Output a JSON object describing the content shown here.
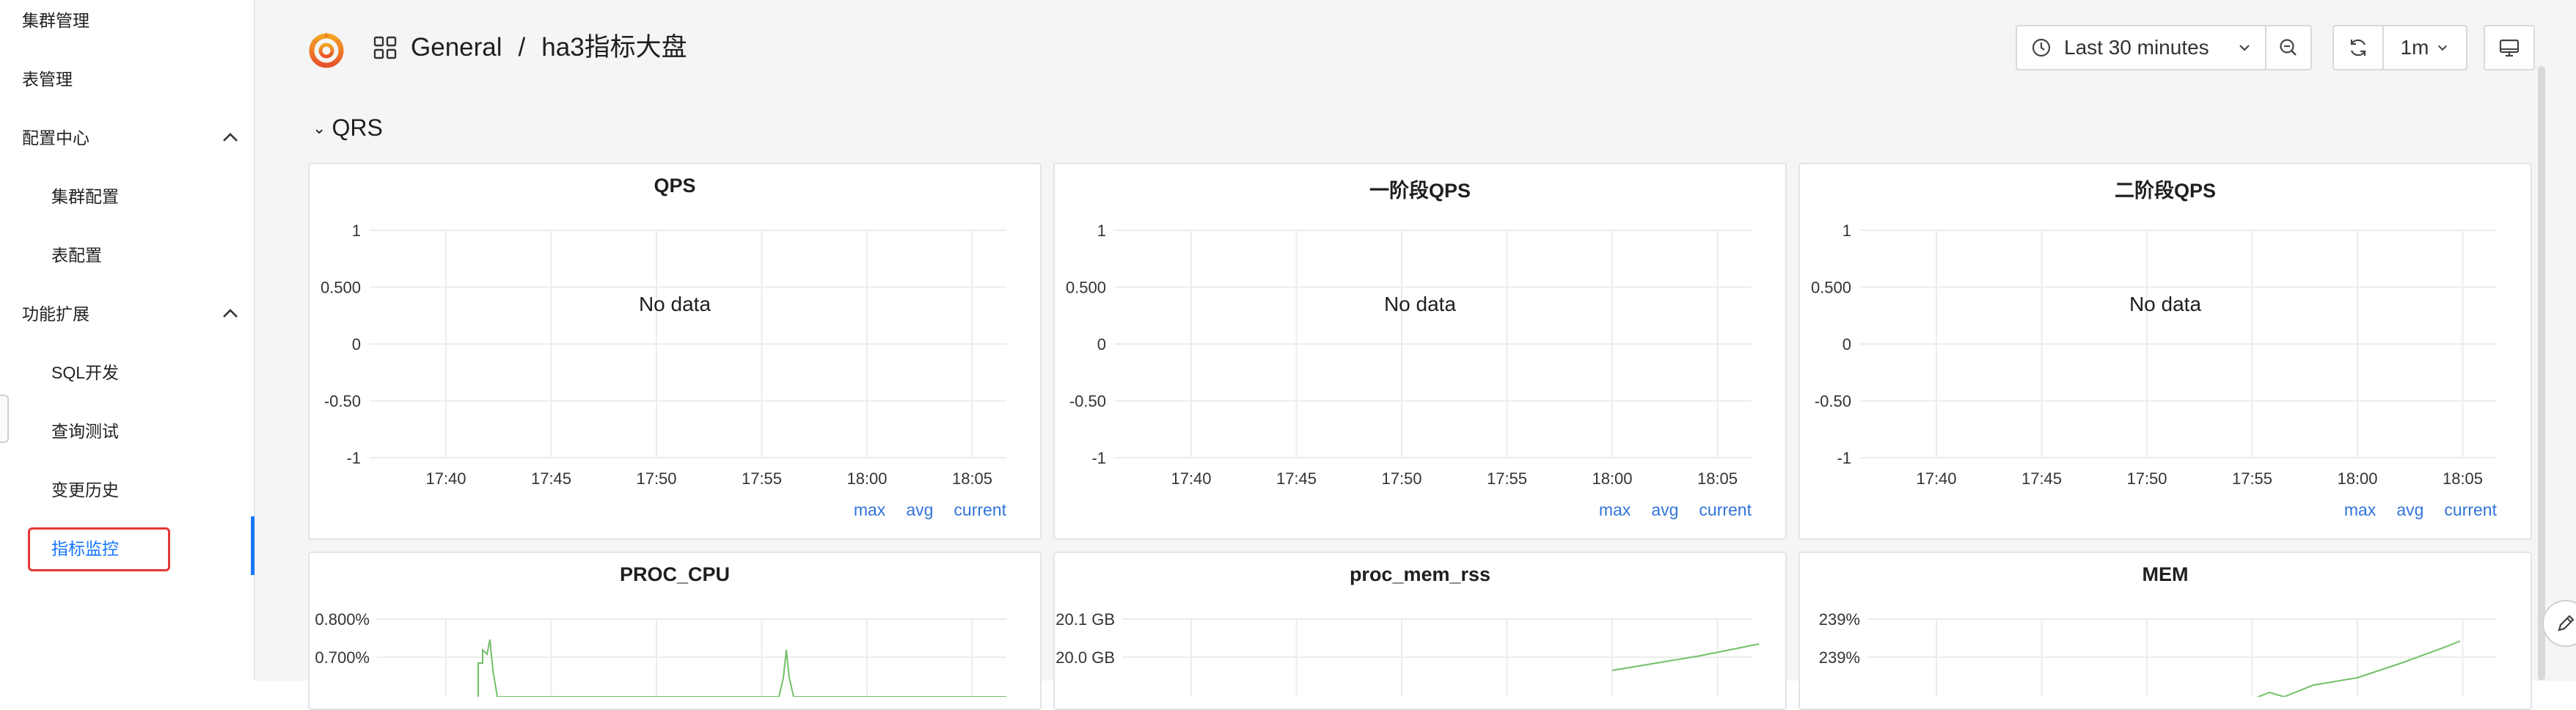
{
  "sidebar": {
    "items": [
      {
        "label": "集群管理"
      },
      {
        "label": "表管理"
      },
      {
        "label": "配置中心"
      },
      {
        "label": "集群配置"
      },
      {
        "label": "表配置"
      },
      {
        "label": "功能扩展"
      },
      {
        "label": "SQL开发"
      },
      {
        "label": "查询测试"
      },
      {
        "label": "变更历史"
      },
      {
        "label": "指标监控"
      }
    ]
  },
  "header": {
    "breadcrumb_folder": "General",
    "breadcrumb_sep": "/",
    "breadcrumb_dashboard": "ha3指标大盘",
    "time_range": "Last 30 minutes",
    "refresh_interval": "1m"
  },
  "row": {
    "title": "QRS"
  },
  "colors": {
    "accent": "#1677ff",
    "legend": "#3274d9",
    "series": "#73bf69",
    "highlight_box": "#e53935"
  },
  "panels": [
    {
      "title": "QPS",
      "no_data": "No data",
      "y_ticks": [
        "1",
        "0.500",
        "0",
        "-0.50",
        "-1"
      ],
      "x_ticks": [
        "17:40",
        "17:45",
        "17:50",
        "17:55",
        "18:00",
        "18:05"
      ],
      "legend": [
        "max",
        "avg",
        "current"
      ]
    },
    {
      "title": "一阶段QPS",
      "no_data": "No data",
      "y_ticks": [
        "1",
        "0.500",
        "0",
        "-0.50",
        "-1"
      ],
      "x_ticks": [
        "17:40",
        "17:45",
        "17:50",
        "17:55",
        "18:00",
        "18:05"
      ],
      "legend": [
        "max",
        "avg",
        "current"
      ]
    },
    {
      "title": "二阶段QPS",
      "no_data": "No data",
      "y_ticks": [
        "1",
        "0.500",
        "0",
        "-0.50",
        "-1"
      ],
      "x_ticks": [
        "17:40",
        "17:45",
        "17:50",
        "17:55",
        "18:00",
        "18:05"
      ],
      "legend": [
        "max",
        "avg",
        "current"
      ]
    },
    {
      "title": "PROC_CPU",
      "y_ticks": [
        "0.800%",
        "0.700%"
      ]
    },
    {
      "title": "proc_mem_rss",
      "y_ticks": [
        "20.1 GB",
        "20.0 GB"
      ]
    },
    {
      "title": "MEM",
      "y_ticks": [
        "239%",
        "239%"
      ]
    }
  ]
}
